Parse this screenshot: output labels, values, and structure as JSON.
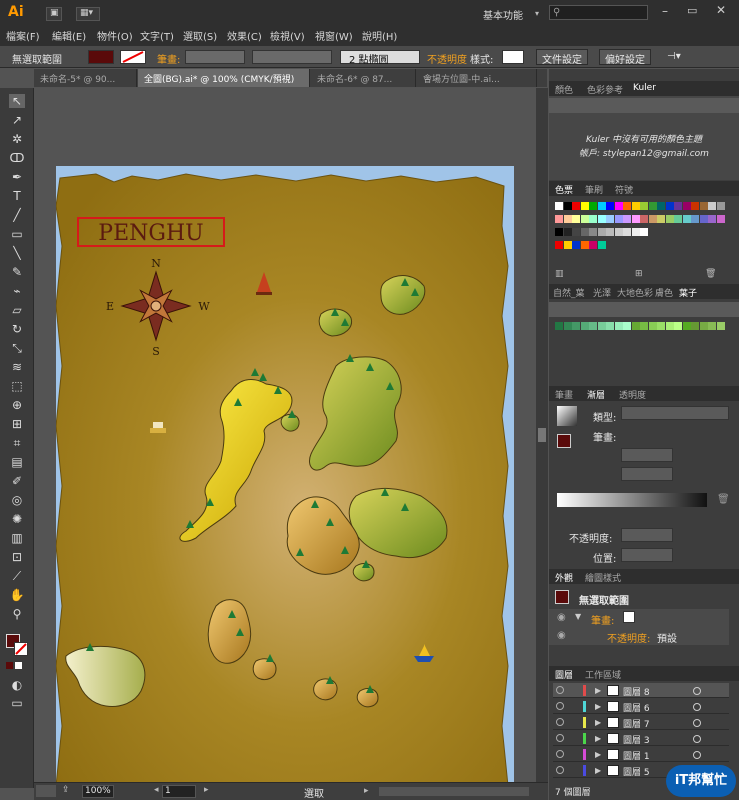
{
  "app": {
    "logo": "Ai",
    "workspace": "基本功能",
    "search_placeholder": ""
  },
  "menu": [
    "檔案(F)",
    "編輯(E)",
    "物件(O)",
    "文字(T)",
    "選取(S)",
    "效果(C)",
    "檢視(V)",
    "視窗(W)",
    "說明(H)"
  ],
  "control": {
    "selection": "無選取範圍",
    "stroke_label": "筆畫:",
    "stroke_weight": "2 點橢圓",
    "opacity_label": "不透明度",
    "style_label": "樣式:",
    "doc_setup": "文件設定",
    "prefs": "偏好設定"
  },
  "tabs": [
    {
      "label": "未命名-5* @ 90..."
    },
    {
      "label": "全圖(BG).ai* @ 100% (CMYK/預視)"
    },
    {
      "label": "未命名-6* @ 87..."
    },
    {
      "label": "會場方位圖-中.ai..."
    }
  ],
  "map": {
    "title": "PENGHU",
    "north": "N",
    "south": "S",
    "east": "E",
    "west": "W"
  },
  "status": {
    "zoom": "100%",
    "page": "1",
    "mode": "選取"
  },
  "panels": {
    "color_tabs": [
      "顏色",
      "色彩參考",
      "Kuler"
    ],
    "kuler_msg": "Kuler 中沒有可用的顏色主題",
    "kuler_account": "帳戶: stylepan12@gmail.com",
    "swatch_tabs": [
      "色票",
      "筆刷",
      "符號"
    ],
    "lib_tabs": [
      "自然_葉",
      "光澤",
      "大地色彩",
      "膚色",
      "葉子"
    ],
    "stroke_tabs": [
      "筆畫",
      "漸層",
      "透明度"
    ],
    "gradient": {
      "type_label": "類型:",
      "stroke_label": "筆畫:",
      "opacity_label": "不透明度:",
      "position_label": "位置:"
    },
    "appearance_tabs": [
      "外觀",
      "繪圖樣式"
    ],
    "appearance": {
      "selection": "無選取範圍",
      "stroke": "筆畫:",
      "opacity": "不透明度:",
      "opacity_value": "預設"
    },
    "layer_tabs": [
      "圖層",
      "工作區域"
    ],
    "layers": [
      {
        "name": "圖層 8",
        "color": "#e14b4b"
      },
      {
        "name": "圖層 6",
        "color": "#4fd6d6"
      },
      {
        "name": "圖層 7",
        "color": "#e8e84b"
      },
      {
        "name": "圖層 3",
        "color": "#4bd64b"
      },
      {
        "name": "圖層 1",
        "color": "#d64bd6"
      },
      {
        "name": "圖層 5",
        "color": "#4b4be1"
      }
    ],
    "layer_count": "7 個圖層"
  },
  "watermark": "iT邦幫忙"
}
